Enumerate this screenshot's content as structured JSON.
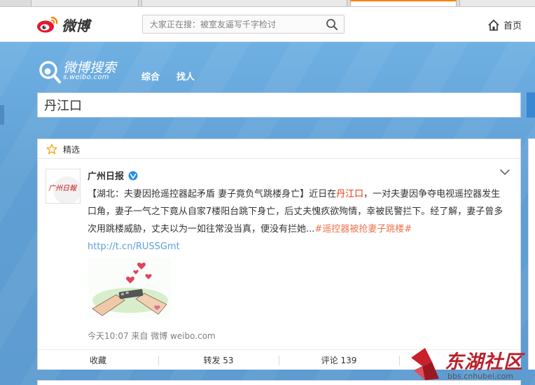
{
  "top_nav": {
    "logo_text": "微博",
    "hot_search_placeholder": "大家正在搜：被室友逼写千字检讨",
    "home_label": "首页"
  },
  "search_header": {
    "logo_name": "微博搜索",
    "logo_sub": "s.weibo.com",
    "tabs": [
      {
        "label": "综合",
        "active": true
      },
      {
        "label": "找人",
        "active": false
      }
    ],
    "query": "丹江口"
  },
  "card": {
    "header_title": "精选",
    "author": "广州日报",
    "avatar_text": "广州日報",
    "post": {
      "part1": "【湖北：夫妻因抢遥控器起矛盾 妻子竟负气跳楼身亡】近日在",
      "highlight": "丹江口",
      "part2": "，一对夫妻因争夺电视遥控器发生口角，妻子一气之下竟从自家7楼阳台跳下身亡，后丈夫愧疚欲殉情，幸被民警拦下。经了解，妻子曾多次用跳楼威胁，丈夫以为一如往常没当真，便没有拦她...",
      "topic": "#遥控器被抢妻子跳楼#",
      "link": "http://t.cn/RUSSGmt"
    },
    "meta": "今天10:07 来自 微博 weibo.com",
    "actions": [
      {
        "label": "收藏"
      },
      {
        "label": "转发 53"
      },
      {
        "label": "评论 139"
      }
    ]
  },
  "watermark": {
    "main": "东湖社区",
    "sub": "bbs.cnhubei.com"
  },
  "colors": {
    "brand_orange": "#ff8200",
    "highlight_red": "#e8320d",
    "topic_orange": "#eb7350",
    "link_blue": "#5d9fd6",
    "background_blue": "#5d9fd6"
  }
}
